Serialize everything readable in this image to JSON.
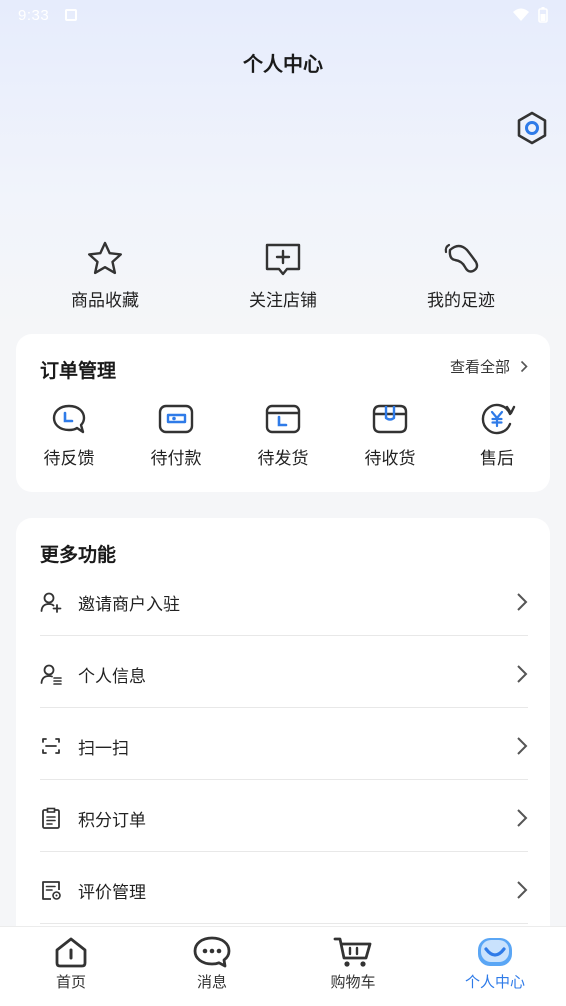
{
  "status_bar": {
    "time": "9:33"
  },
  "header": {
    "title": "个人中心"
  },
  "quick_actions": [
    {
      "label": "商品收藏",
      "icon": "star-icon"
    },
    {
      "label": "关注店铺",
      "icon": "store-follow-icon"
    },
    {
      "label": "我的足迹",
      "icon": "footprint-icon"
    }
  ],
  "orders": {
    "title": "订单管理",
    "view_all": "查看全部",
    "items": [
      {
        "label": "待反馈",
        "icon": "feedback-icon"
      },
      {
        "label": "待付款",
        "icon": "payment-icon"
      },
      {
        "label": "待发货",
        "icon": "ship-icon"
      },
      {
        "label": "待收货",
        "icon": "receive-icon"
      },
      {
        "label": "售后",
        "icon": "after-sales-icon"
      }
    ]
  },
  "more": {
    "title": "更多功能",
    "items": [
      {
        "label": "邀请商户入驻",
        "icon": "invite-user-icon"
      },
      {
        "label": "个人信息",
        "icon": "profile-icon"
      },
      {
        "label": "扫一扫",
        "icon": "scan-icon"
      },
      {
        "label": "积分订单",
        "icon": "clipboard-icon"
      },
      {
        "label": "评价管理",
        "icon": "review-icon"
      }
    ]
  },
  "tabs": [
    {
      "label": "首页",
      "icon": "home-icon",
      "active": false
    },
    {
      "label": "消息",
      "icon": "message-icon",
      "active": false
    },
    {
      "label": "购物车",
      "icon": "cart-icon",
      "active": false
    },
    {
      "label": "个人中心",
      "icon": "profile-tab-icon",
      "active": true
    }
  ],
  "colors": {
    "accent": "#2f7be8",
    "icon": "#333333"
  }
}
